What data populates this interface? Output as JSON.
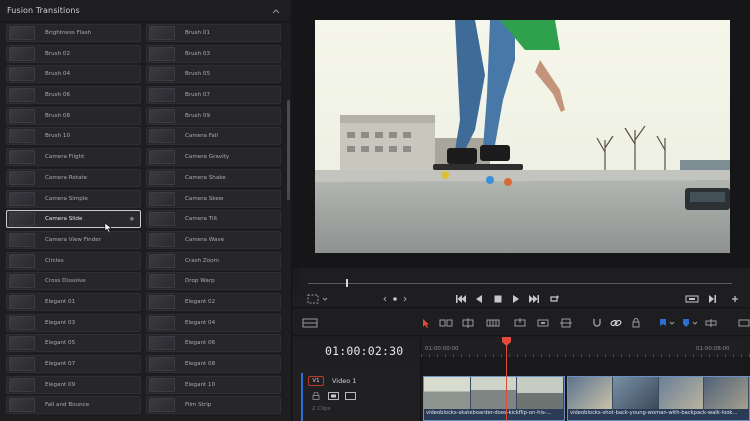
{
  "panel": {
    "title": "Fusion Transitions",
    "selected_item": "Camera Slide",
    "items": [
      "Brightness Flash",
      "Brush 01",
      "Brush 02",
      "Brush 03",
      "Brush 04",
      "Brush 05",
      "Brush 06",
      "Brush 07",
      "Brush 08",
      "Brush 09",
      "Brush 10",
      "Camera Fall",
      "Camera Flight",
      "Camera Gravity",
      "Camera Rotate",
      "Camera Shake",
      "Camera Simple",
      "Camera Skew",
      "Camera Slide",
      "Camera Tilt",
      "Camera View Finder",
      "Camera Wave",
      "Circles",
      "Crash Zoom",
      "Cross Dissolve",
      "Drop Warp",
      "Elegant 01",
      "Elegant 02",
      "Elegant 03",
      "Elegant 04",
      "Elegant 05",
      "Elegant 06",
      "Elegant 07",
      "Elegant 08",
      "Elegant 09",
      "Elegant 10",
      "Fall and Bounce",
      "Film Strip"
    ]
  },
  "timeline": {
    "timecode": "01:00:02:30",
    "ruler_labels": [
      "01:00:00:00",
      "01:00:08:00"
    ],
    "playhead_progress": 0.1,
    "track": {
      "id": "V1",
      "name": "Video 1",
      "clips_label": "2 Clips"
    },
    "clips": [
      {
        "name": "videoblocks-skateboarder-does-kickflip-on-his-..."
      },
      {
        "name": "videoblocks-shot-back-young-woman-with-backpack-walk-look..."
      }
    ]
  },
  "icons": {
    "transport": [
      "prev-edit-icon",
      "reverse-play-icon",
      "stop-icon",
      "play-icon",
      "next-edit-icon",
      "loop-icon"
    ],
    "toolbar": [
      "selection-mode-icon",
      "trim-mode-icon",
      "blade-icon",
      "insert-clip-icon",
      "snap-icon",
      "link-icon",
      "lock-icon",
      "flag-icon",
      "marker-icon",
      "zoom-icon"
    ]
  },
  "colors": {
    "accent_blue": "#2a6fd1",
    "playhead_red": "#e14b3a",
    "clip_border": "#6c8fc4",
    "panel_bg": "#1e1e21"
  }
}
